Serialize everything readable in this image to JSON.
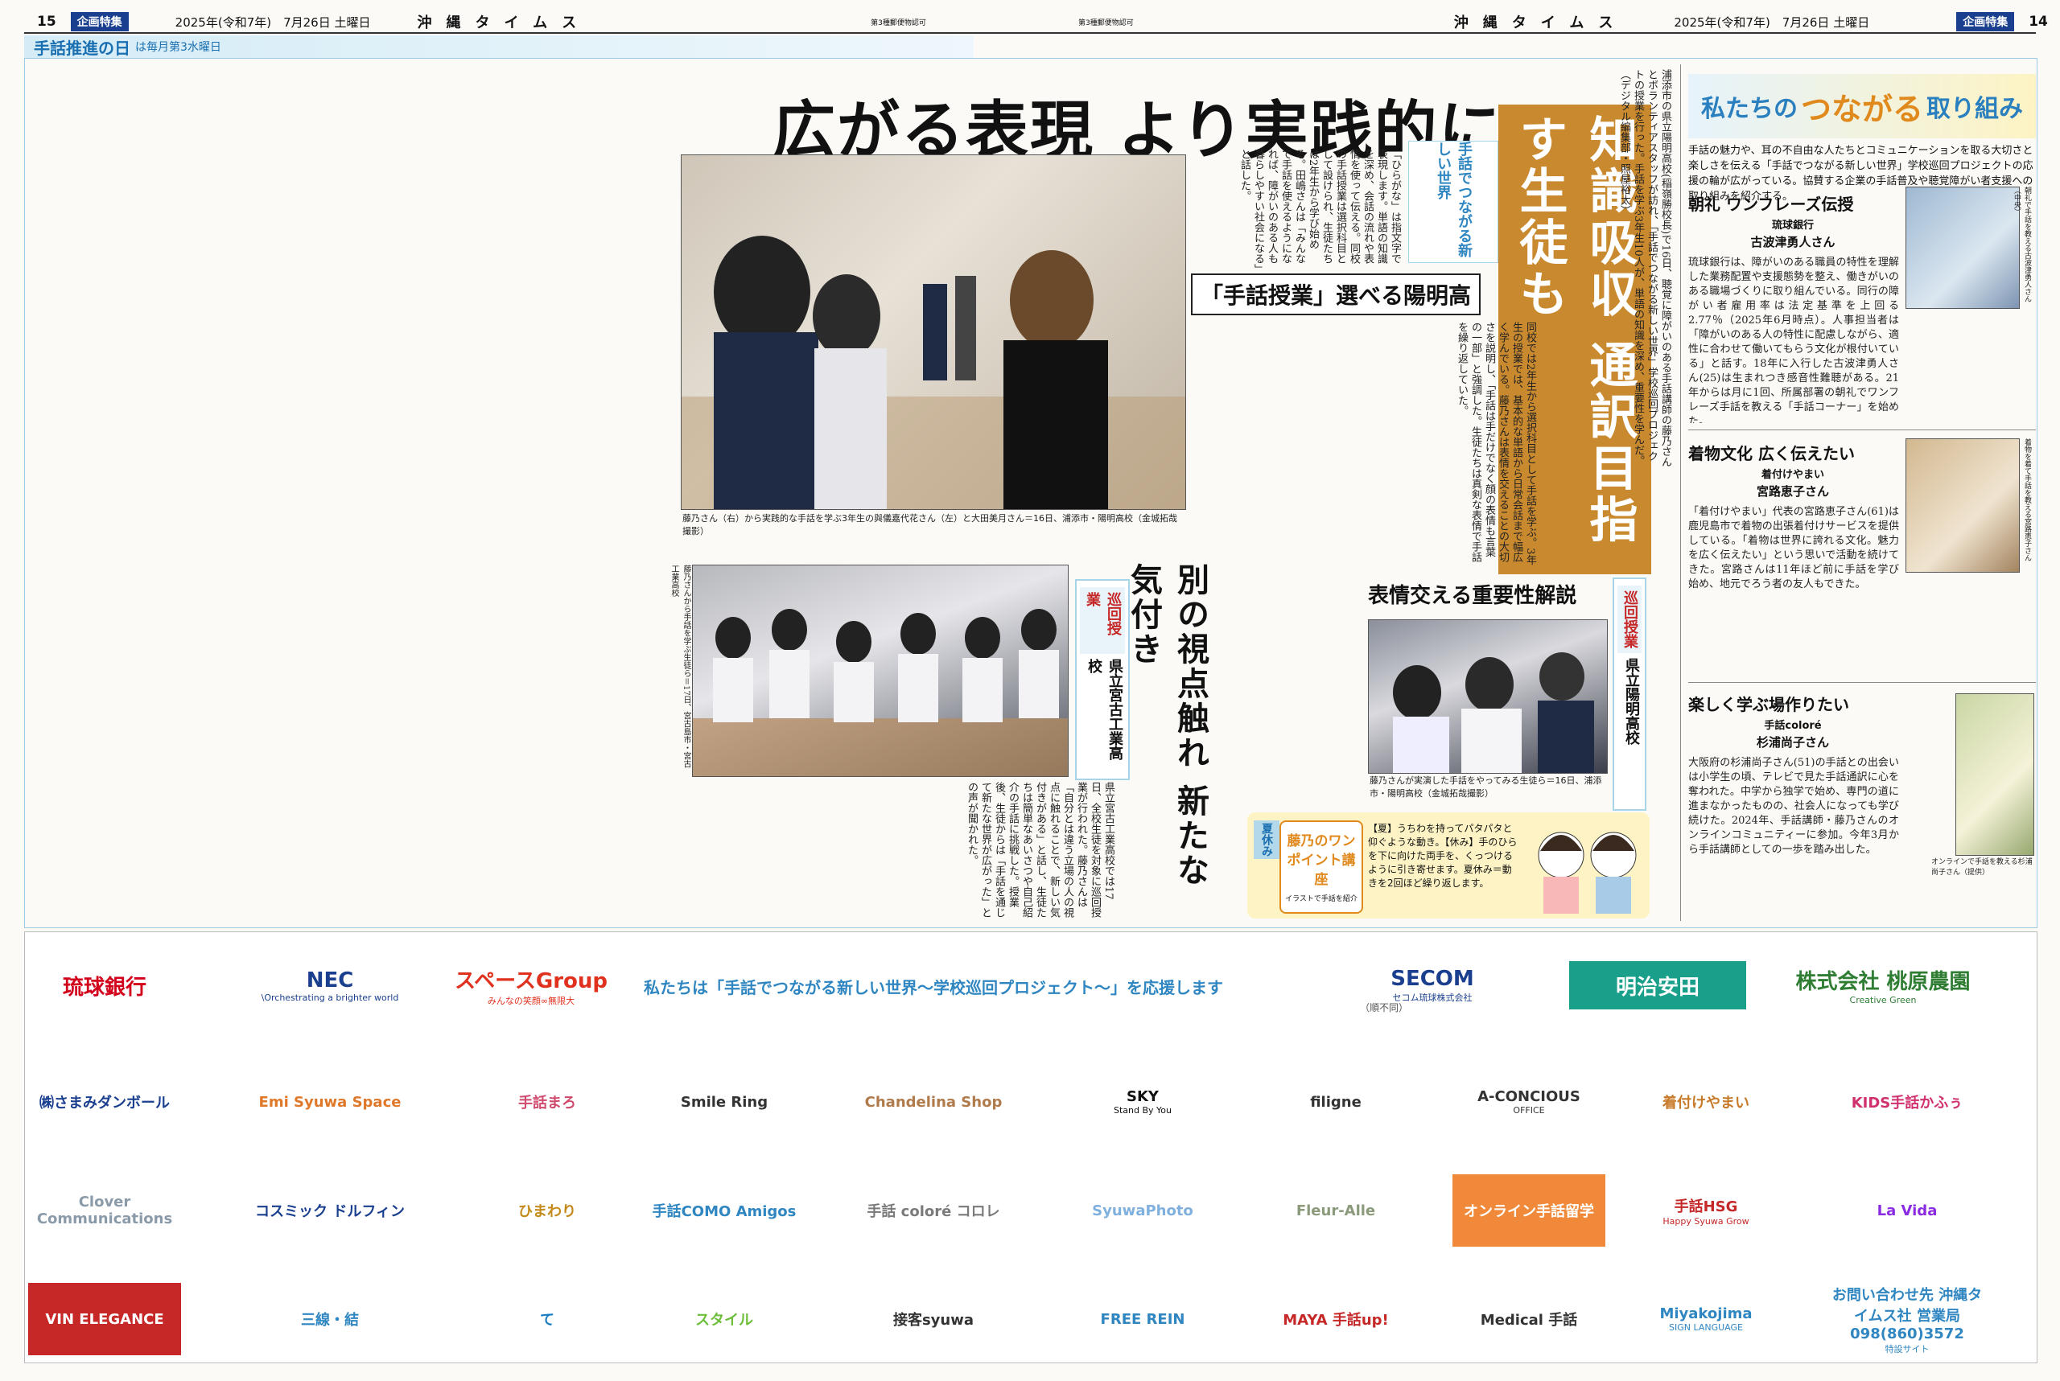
{
  "header_left": {
    "page": "15",
    "section": "企画特集",
    "date": "2025年(令和7年)　7月26日 土曜日",
    "masthead": "沖縄タイムス",
    "note": "第3種郵便物認可"
  },
  "header_right": {
    "page": "14",
    "section": "企画特集",
    "date": "2025年(令和7年)　7月26日 土曜日",
    "masthead": "沖縄タイムス",
    "note": "第3種郵便物認可"
  },
  "band": {
    "title": "手話推進の日",
    "sub": "は毎月第3水曜日"
  },
  "headline": "広がる表現 より実践的に",
  "side_headline": "知識吸収 通訳目指す生徒も",
  "logo_small": "手話でつながる新しい世界",
  "sub_head1": "「手話授業」選べる陽明高",
  "sub_head2": "表情交える重要性解説",
  "vhead": "別の視点触れ 新たな気付き",
  "schools": [
    {
      "kind": "巡回授業",
      "name": "県立陽明高校"
    },
    {
      "kind": "巡回授業",
      "name": "県立宮古工業高校"
    }
  ],
  "captions": {
    "main": "藤乃さん（右）から実践的な手話を学ぶ3年生の與儀嘉代花さん（左）と大田美月さん＝16日、浦添市・陽明高校（金城拓哉撮影）",
    "second": "藤乃さんが実演した手話をやってみる生徒ら＝16日、浦添市・陽明高校（金城拓哉撮影）",
    "third": "藤乃さんから手話を学ぶ生徒ら＝17日、宮古島市・宮古工業高校"
  },
  "lede": "浦添市の県立陽明高校(稲嶺勝校長)で16日、聴覚に障がいのある手話講師の藤乃さんとボランティアスタッフが訪れ、「手話でつながる新しい世界」学校巡回プロジェクトの授業を行った。手話を学ぶ3年生10人が、単語の知識を深め、重要性を学んだ。（デジタル編集部・照屋裕太）",
  "body1": "「ひらがな」は指文字で表現します。単語の知識を深め、会話の流れや表情を使って伝える。同校の手話授業は選択科目として設けられ、生徒たちは2年生から学び始める。田嶋さんは「みんなで手話を使えるようになれば、障がいのある人も暮らしやすい社会になる」と話した。",
  "body2": "同校では2年生から選択科目として手話を学ぶ。3年生の授業では、基本的な単語から日常会話まで幅広く学んでいる。藤乃さんは表情を交えることの大切さを説明し、「手話は手だけでなく顔の表情も言葉の一部」と強調した。生徒たちは真剣な表情で手話を繰り返していた。",
  "body3": "県立宮古工業高校では17日、全校生徒を対象に巡回授業が行われた。藤乃さんは「自分とは違う立場の人の視点に触れることで、新しい気付きがある」と話し、生徒たちは簡単なあいさつや自己紹介の手話に挑戦した。授業後、生徒からは「手話を通じて新たな世界が広がった」との声が聞かれた。",
  "lesson": {
    "label": "夏休み",
    "title": "藤乃のワンポイント講座",
    "subtitle": "イラストで手話を紹介",
    "text": "【夏】うちわを持ってパタパタと仰ぐような動き。【休み】手のひらを下に向けた両手を、くっつけるように引き寄せます。夏休み＝動きを2回ほど繰り返します。"
  },
  "right": {
    "title_a": "私たちの",
    "title_b": "つながる",
    "title_c": "取り組み",
    "intro": "手話の魅力や、耳の不自由な人たちとコミュニケーションを取る大切さと楽しさを伝える「手話でつながる新しい世界」学校巡回プロジェクトの応援の輪が広がっている。協賛する企業の手話普及や聴覚障がい者支援への取り組みを紹介する。",
    "sections": [
      {
        "head": "朝礼 ワンフレーズ伝授",
        "company": "琉球銀行",
        "name": "古波津勇人さん",
        "body": "琉球銀行は、障がいのある職員の特性を理解した業務配置や支援態勢を整え、働きがいのある職場づくりに取り組んでいる。同行の障がい者雇用率は法定基準を上回る2.77％（2025年6月時点）。人事担当者は「障がいのある人の特性に配慮しながら、適性に合わせて働いてもらう文化が根付いている」と話す。18年に入行した古波津勇人さん(25)は生まれつき感音性難聴がある。21年からは月に1回、所属部署の朝礼でワンフレーズ手話を教える「手話コーナー」を始めた。"
      },
      {
        "head": "着物文化 広く伝えたい",
        "company": "着付けやまい",
        "name": "宮路恵子さん",
        "body": "「着付けやまい」代表の宮路恵子さん(61)は鹿児島市で着物の出張着付けサービスを提供している。「着物は世界に誇れる文化。魅力を広く伝えたい」という思いで活動を続けてきた。宮路さんは11年ほど前に手話を学び始め、地元でろう者の友人もできた。"
      },
      {
        "head": "楽しく学ぶ場作りたい",
        "company": "手話coloré",
        "name": "杉浦尚子さん",
        "body": "大阪府の杉浦尚子さん(51)の手話との出会いは小学生の頃、テレビで見た手話通訳に心を奪われた。中学から独学で始め、専門の道に進まなかったものの、社会人になっても学び続けた。2024年、手話講師・藤乃さんのオンラインコミュニティーに参加。今年3月から手話講師としての一歩を踏み出した。"
      }
    ],
    "photo_caps": [
      "朝礼で手話を教える古波津勇人さん（中央）",
      "着物を着て手話を教える宮路恵子さん",
      "オンラインで手話を教える杉浦尚子さん（提供）"
    ]
  },
  "ad": {
    "slogan": "私たちは「手話でつながる新しい世界～学校巡回プロジェクト～」を応援します",
    "slogan_note": "（順不同）",
    "logos": [
      {
        "text": "琉球銀行",
        "color": "#d2001a"
      },
      {
        "text": "NEC",
        "sub": "\\Orchestrating a brighter world",
        "color": "#1b3f8f"
      },
      {
        "text": "スペースGroup",
        "sub": "みんなの笑顔∞無限大",
        "color": "#e0301e"
      },
      {
        "text": "SECOM",
        "sub": "セコム琉球株式会社",
        "color": "#1b3f8f"
      },
      {
        "text": "明治安田",
        "color": "#ffffff"
      },
      {
        "text": "株式会社 桃原農園",
        "sub": "Creative Green",
        "color": "#2e7d32"
      },
      {
        "text": "㈱さまみダンボール",
        "color": "#1b3f8f"
      },
      {
        "text": "Emi Syuwa Space",
        "color": "#e0782a"
      },
      {
        "text": "手話まろ",
        "color": "#d04a6e"
      },
      {
        "text": "Smile Ring",
        "color": "#333333"
      },
      {
        "text": "Chandelina Shop",
        "color": "#b07a4a"
      },
      {
        "text": "SKY",
        "sub": "Stand By You",
        "color": "#111111"
      },
      {
        "text": "filigne",
        "color": "#333333"
      },
      {
        "text": "A-CONCIOUS",
        "sub": "OFFICE",
        "color": "#333333"
      },
      {
        "text": "着付けやまい",
        "color": "#c77a2a"
      },
      {
        "text": "KIDS手話かふぅ",
        "color": "#d0306e"
      },
      {
        "text": "Clover Communications",
        "color": "#8a9aa8"
      },
      {
        "text": "コスミック ドルフィン",
        "color": "#1b3f8f"
      },
      {
        "text": "ひまわり",
        "color": "#c58a1c"
      },
      {
        "text": "手話COMO Amigos",
        "color": "#2f86c1"
      },
      {
        "text": "手話 coloré コロレ",
        "color": "#7a7a7a"
      },
      {
        "text": "SyuwaPhoto",
        "color": "#7fb0de"
      },
      {
        "text": "Fleur-Alle",
        "color": "#8a9a7a"
      },
      {
        "text": "オンライン手話留学",
        "color": "#ffffff"
      },
      {
        "text": "手話HSG",
        "sub": "Happy Syuwa Grow",
        "color": "#c62828"
      },
      {
        "text": "La Vida",
        "color": "#8a2be2"
      },
      {
        "text": "VIN ELEGANCE",
        "color": "#ffffff"
      },
      {
        "text": "三線・結",
        "color": "#2f86c1"
      },
      {
        "text": "て",
        "color": "#1b7cc1"
      },
      {
        "text": "スタイル",
        "color": "#6dbf3a"
      },
      {
        "text": "接客syuwa",
        "color": "#333333"
      },
      {
        "text": "FREE REIN",
        "color": "#2f86c1"
      },
      {
        "text": "MAYA 手話up!",
        "color": "#c62828"
      },
      {
        "text": "Medical 手話",
        "color": "#333333"
      },
      {
        "text": "Miyakojima",
        "sub": "SIGN LANGUAGE",
        "color": "#2f86c1"
      },
      {
        "text": "お問い合わせ先 沖縄タイムス社 営業局 098(860)3572",
        "sub": "特設サイト",
        "color": "#2f86c1"
      }
    ]
  },
  "colors": {
    "accent": "#c9892f",
    "blue": "#2f86c1",
    "band": "#d5ecf7",
    "lesson_bg": "#fdf3c4"
  }
}
